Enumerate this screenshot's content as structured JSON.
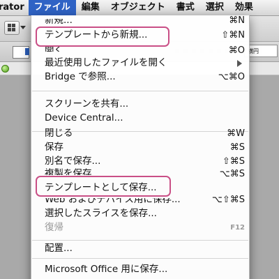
{
  "menubar": {
    "app_name": "rator",
    "menus": [
      "ファイル",
      "編集",
      "オブジェクト",
      "書式",
      "選択",
      "効果"
    ],
    "active_index": 0
  },
  "background": {
    "right_field_text": "横円"
  },
  "colors": {
    "menu_active": "#2f63c5",
    "highlight_border": "#c94f86"
  },
  "file_menu": {
    "items": [
      {
        "label": "新規...",
        "shortcut": "⌘N"
      },
      {
        "label": "テンプレートから新規...",
        "shortcut": "⇧⌘N"
      },
      {
        "label": "開く...",
        "shortcut": "⌘O"
      },
      {
        "label": "最近使用したファイルを開く",
        "shortcut": ""
      },
      {
        "label": "Bridge で参照...",
        "shortcut": "⌥⌘O"
      },
      {
        "label": "スクリーンを共有...",
        "shortcut": ""
      },
      {
        "label": "Device Central...",
        "shortcut": ""
      },
      {
        "label": "閉じる",
        "shortcut": "⌘W"
      },
      {
        "label": "保存",
        "shortcut": "⌘S"
      },
      {
        "label": "別名で保存...",
        "shortcut": "⇧⌘S"
      },
      {
        "label": "複製を保存...",
        "shortcut": "⌥⌘S"
      },
      {
        "label": "テンプレートとして保存...",
        "shortcut": ""
      },
      {
        "label": "Web およびデバイス用に保存...",
        "shortcut": "⌥⇧⌘S"
      },
      {
        "label": "選択したスライスを保存...",
        "shortcut": ""
      },
      {
        "label": "復帰",
        "shortcut": "F12"
      },
      {
        "label": "配置...",
        "shortcut": ""
      },
      {
        "label": "Microsoft Office 用に保存...",
        "shortcut": ""
      }
    ]
  }
}
